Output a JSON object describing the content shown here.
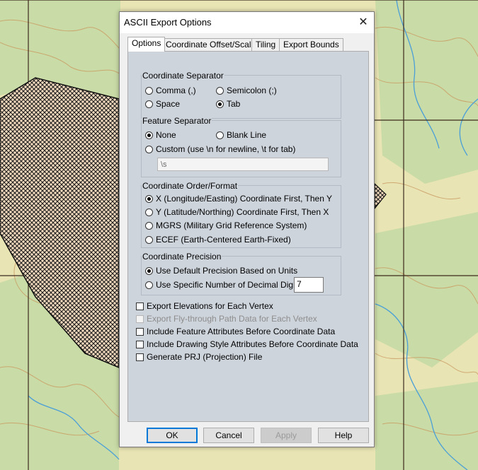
{
  "dialog": {
    "title": "ASCII Export Options",
    "close_glyph": "✕",
    "tabs": [
      {
        "label": "Options",
        "active": true
      },
      {
        "label": "Coordinate Offset/Scale",
        "active": false
      },
      {
        "label": "Tiling",
        "active": false
      },
      {
        "label": "Export Bounds",
        "active": false
      }
    ]
  },
  "coordinate_separator": {
    "title": "Coordinate Separator",
    "options": [
      "Comma (,)",
      "Semicolon (;)",
      "Space",
      "Tab"
    ],
    "selected": "Tab"
  },
  "feature_separator": {
    "title": "Feature Separator",
    "options": [
      "None",
      "Blank Line",
      "Custom (use \\n for newline, \\t for tab)"
    ],
    "selected": "None",
    "custom_value": "\\s"
  },
  "coordinate_order": {
    "title": "Coordinate Order/Format",
    "options": [
      "X (Longitude/Easting) Coordinate First, Then Y",
      "Y (Latitude/Northing) Coordinate First, Then X",
      "MGRS (Military Grid Reference System)",
      "ECEF (Earth-Centered Earth-Fixed)"
    ],
    "selected": "X (Longitude/Easting) Coordinate First, Then Y"
  },
  "coordinate_precision": {
    "title": "Coordinate Precision",
    "options": [
      "Use Default Precision Based on Units",
      "Use Specific Number of Decimal Digits:"
    ],
    "selected": "Use Default Precision Based on Units",
    "decimal_digits": "7"
  },
  "checkboxes": [
    {
      "label": "Export Elevations for Each Vertex",
      "checked": false,
      "enabled": true
    },
    {
      "label": "Export Fly-through Path Data for Each Vertex",
      "checked": false,
      "enabled": false
    },
    {
      "label": "Include Feature Attributes Before Coordinate Data",
      "checked": false,
      "enabled": true
    },
    {
      "label": "Include Drawing Style Attributes Before Coordinate Data",
      "checked": false,
      "enabled": true
    },
    {
      "label": "Generate PRJ (Projection) File",
      "checked": false,
      "enabled": true
    }
  ],
  "buttons": {
    "ok": "OK",
    "cancel": "Cancel",
    "apply": "Apply",
    "help": "Help"
  },
  "colors": {
    "map_background": "#e9e4b4",
    "forest": "#c3d9a3",
    "river": "#4a9fd8",
    "contour": "#c99b62",
    "grid": "#3b2a1e",
    "panel": "#ced4dc",
    "focus": "#0078d7"
  }
}
